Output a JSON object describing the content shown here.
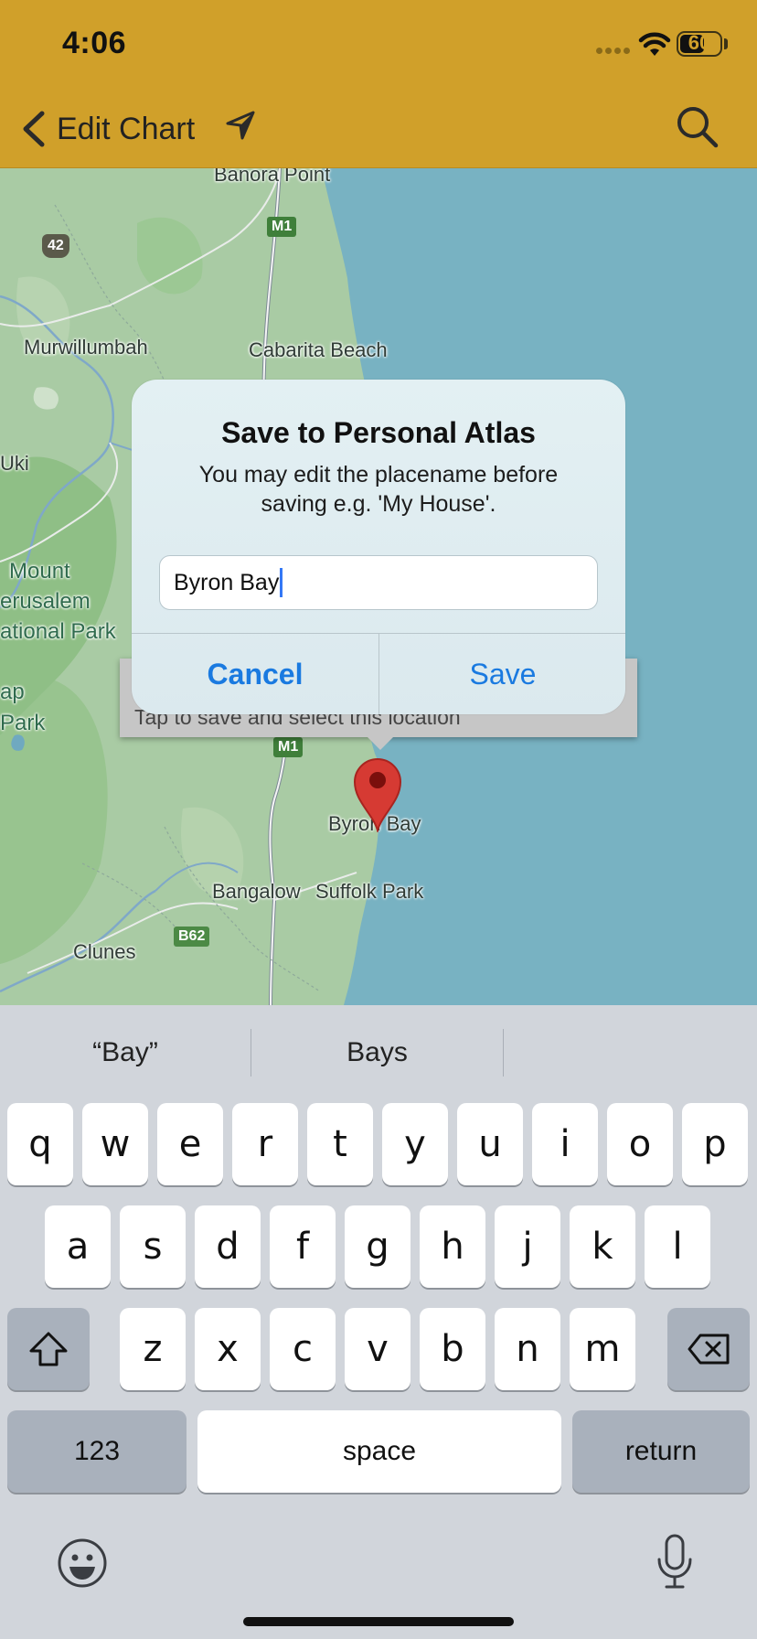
{
  "status_bar": {
    "time": "4:06",
    "battery": "60"
  },
  "nav": {
    "back_label": "Edit Chart",
    "icons": [
      "chevron-left-icon",
      "location-arrow-icon",
      "search-icon"
    ]
  },
  "map": {
    "places": {
      "banora_point": "Banora Point",
      "murwillumbah": "Murwillumbah",
      "cabarita_beach": "Cabarita Beach",
      "uki": "Uki",
      "mount": "Mount",
      "jerusalem": "erusalem",
      "national_park": "ational Park",
      "ap": "ap",
      "park": "Park",
      "byron_bay": "Byron Bay",
      "bangalow": "Bangalow",
      "suffolk_park": "Suffolk Park",
      "clunes": "Clunes"
    },
    "road_shields": {
      "m1_top": "M1",
      "m1_mid": "M1",
      "r42": "42",
      "b62": "B62"
    },
    "callout_text": "Tap to save and select this location",
    "colors": {
      "land": "#a9cba4",
      "sea": "#78b2c2",
      "pin": "#d63a33"
    }
  },
  "alert": {
    "title": "Save to Personal Atlas",
    "message": "You may edit the placename before saving e.g. 'My House'.",
    "input_value": "Byron Bay",
    "cancel_label": "Cancel",
    "save_label": "Save",
    "accent": "#1a7ae0"
  },
  "keyboard": {
    "suggestions": [
      "“Bay”",
      "Bays",
      ""
    ],
    "row1": [
      "q",
      "w",
      "e",
      "r",
      "t",
      "y",
      "u",
      "i",
      "o",
      "p"
    ],
    "row2": [
      "a",
      "s",
      "d",
      "f",
      "g",
      "h",
      "j",
      "k",
      "l"
    ],
    "row3": [
      "z",
      "x",
      "c",
      "v",
      "b",
      "n",
      "m"
    ],
    "numbers_label": "123",
    "space_label": "space",
    "return_label": "return"
  }
}
